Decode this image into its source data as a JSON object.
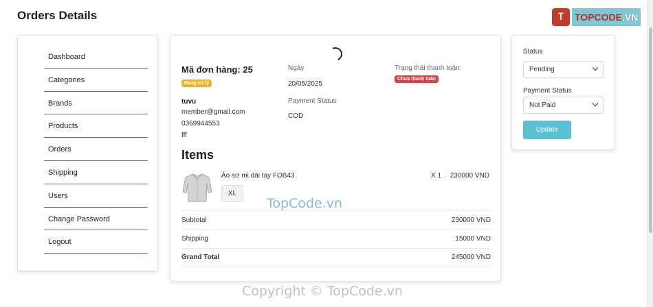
{
  "header": {
    "title": "Orders Details"
  },
  "logo": {
    "mark": "T",
    "brand_red": "TOPCODE",
    "brand_rest": ".VN"
  },
  "sidebar": {
    "items": [
      {
        "label": "Dashboard"
      },
      {
        "label": "Categories"
      },
      {
        "label": "Brands"
      },
      {
        "label": "Products"
      },
      {
        "label": "Orders"
      },
      {
        "label": "Shipping"
      },
      {
        "label": "Users"
      },
      {
        "label": "Change Password"
      },
      {
        "label": "Logout"
      }
    ]
  },
  "order": {
    "title": "Mã đơn hàng: 25",
    "status_badge": "Đang xử lý",
    "customer_name": "tuvu",
    "email": "member@gmail.com",
    "phone": "0369944553",
    "address": "fff",
    "date_label": "Ngày",
    "date_value": "20/05/2025",
    "payment_status_label": "Payment Status",
    "payment_method": "COD",
    "payment_state_label": "Trạng thái thanh toán:",
    "payment_state_badge": "Chưa thanh toán"
  },
  "items": {
    "heading": "Items",
    "list": [
      {
        "name": "Áo sơ mi dài tay FOB43",
        "size": "XL",
        "qty": "X 1",
        "price": "230000 VND",
        "icon": "shirt-icon"
      }
    ]
  },
  "summary": {
    "subtotal_label": "Subtotal",
    "subtotal_value": "230000 VND",
    "shipping_label": "Shipping",
    "shipping_value": "15000 VND",
    "grand_label": "Grand Total",
    "grand_value": "245000 VND"
  },
  "status_panel": {
    "status_label": "Status",
    "status_value": "Pending",
    "payment_label": "Payment Status",
    "payment_value": "Not Paid",
    "update_label": "Update"
  },
  "watermarks": {
    "center": "TopCode.vn",
    "bottom": "Copyright © TopCode.vn"
  },
  "colors": {
    "accent": "#5bc0d4",
    "badge_processing": "#f0b429",
    "badge_unpaid": "#d64545",
    "logo_red": "#c0392b"
  }
}
